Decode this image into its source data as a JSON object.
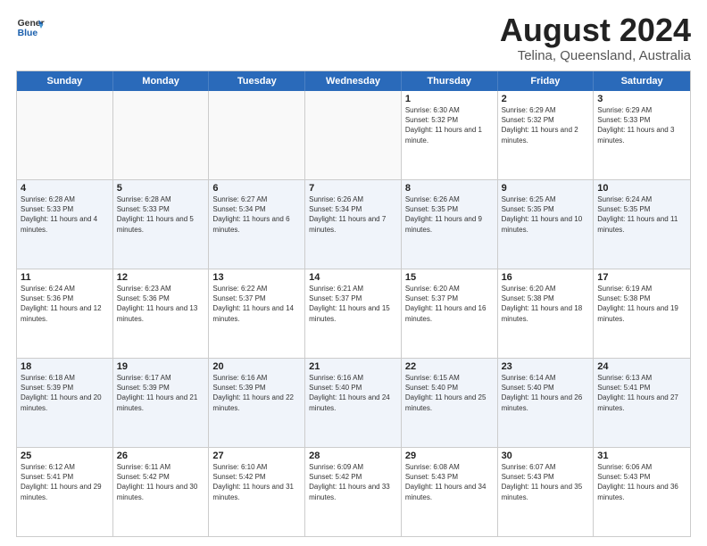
{
  "header": {
    "logo_line1": "General",
    "logo_line2": "Blue",
    "title": "August 2024",
    "subtitle": "Telina, Queensland, Australia"
  },
  "calendar": {
    "days_of_week": [
      "Sunday",
      "Monday",
      "Tuesday",
      "Wednesday",
      "Thursday",
      "Friday",
      "Saturday"
    ],
    "weeks": [
      [
        {
          "day": "",
          "empty": true
        },
        {
          "day": "",
          "empty": true
        },
        {
          "day": "",
          "empty": true
        },
        {
          "day": "",
          "empty": true
        },
        {
          "day": "1",
          "sunrise": "6:30 AM",
          "sunset": "5:32 PM",
          "daylight": "11 hours and 1 minute."
        },
        {
          "day": "2",
          "sunrise": "6:29 AM",
          "sunset": "5:32 PM",
          "daylight": "11 hours and 2 minutes."
        },
        {
          "day": "3",
          "sunrise": "6:29 AM",
          "sunset": "5:33 PM",
          "daylight": "11 hours and 3 minutes."
        }
      ],
      [
        {
          "day": "4",
          "sunrise": "6:28 AM",
          "sunset": "5:33 PM",
          "daylight": "11 hours and 4 minutes."
        },
        {
          "day": "5",
          "sunrise": "6:28 AM",
          "sunset": "5:33 PM",
          "daylight": "11 hours and 5 minutes."
        },
        {
          "day": "6",
          "sunrise": "6:27 AM",
          "sunset": "5:34 PM",
          "daylight": "11 hours and 6 minutes."
        },
        {
          "day": "7",
          "sunrise": "6:26 AM",
          "sunset": "5:34 PM",
          "daylight": "11 hours and 7 minutes."
        },
        {
          "day": "8",
          "sunrise": "6:26 AM",
          "sunset": "5:35 PM",
          "daylight": "11 hours and 9 minutes."
        },
        {
          "day": "9",
          "sunrise": "6:25 AM",
          "sunset": "5:35 PM",
          "daylight": "11 hours and 10 minutes."
        },
        {
          "day": "10",
          "sunrise": "6:24 AM",
          "sunset": "5:35 PM",
          "daylight": "11 hours and 11 minutes."
        }
      ],
      [
        {
          "day": "11",
          "sunrise": "6:24 AM",
          "sunset": "5:36 PM",
          "daylight": "11 hours and 12 minutes."
        },
        {
          "day": "12",
          "sunrise": "6:23 AM",
          "sunset": "5:36 PM",
          "daylight": "11 hours and 13 minutes."
        },
        {
          "day": "13",
          "sunrise": "6:22 AM",
          "sunset": "5:37 PM",
          "daylight": "11 hours and 14 minutes."
        },
        {
          "day": "14",
          "sunrise": "6:21 AM",
          "sunset": "5:37 PM",
          "daylight": "11 hours and 15 minutes."
        },
        {
          "day": "15",
          "sunrise": "6:20 AM",
          "sunset": "5:37 PM",
          "daylight": "11 hours and 16 minutes."
        },
        {
          "day": "16",
          "sunrise": "6:20 AM",
          "sunset": "5:38 PM",
          "daylight": "11 hours and 18 minutes."
        },
        {
          "day": "17",
          "sunrise": "6:19 AM",
          "sunset": "5:38 PM",
          "daylight": "11 hours and 19 minutes."
        }
      ],
      [
        {
          "day": "18",
          "sunrise": "6:18 AM",
          "sunset": "5:39 PM",
          "daylight": "11 hours and 20 minutes."
        },
        {
          "day": "19",
          "sunrise": "6:17 AM",
          "sunset": "5:39 PM",
          "daylight": "11 hours and 21 minutes."
        },
        {
          "day": "20",
          "sunrise": "6:16 AM",
          "sunset": "5:39 PM",
          "daylight": "11 hours and 22 minutes."
        },
        {
          "day": "21",
          "sunrise": "6:16 AM",
          "sunset": "5:40 PM",
          "daylight": "11 hours and 24 minutes."
        },
        {
          "day": "22",
          "sunrise": "6:15 AM",
          "sunset": "5:40 PM",
          "daylight": "11 hours and 25 minutes."
        },
        {
          "day": "23",
          "sunrise": "6:14 AM",
          "sunset": "5:40 PM",
          "daylight": "11 hours and 26 minutes."
        },
        {
          "day": "24",
          "sunrise": "6:13 AM",
          "sunset": "5:41 PM",
          "daylight": "11 hours and 27 minutes."
        }
      ],
      [
        {
          "day": "25",
          "sunrise": "6:12 AM",
          "sunset": "5:41 PM",
          "daylight": "11 hours and 29 minutes."
        },
        {
          "day": "26",
          "sunrise": "6:11 AM",
          "sunset": "5:42 PM",
          "daylight": "11 hours and 30 minutes."
        },
        {
          "day": "27",
          "sunrise": "6:10 AM",
          "sunset": "5:42 PM",
          "daylight": "11 hours and 31 minutes."
        },
        {
          "day": "28",
          "sunrise": "6:09 AM",
          "sunset": "5:42 PM",
          "daylight": "11 hours and 33 minutes."
        },
        {
          "day": "29",
          "sunrise": "6:08 AM",
          "sunset": "5:43 PM",
          "daylight": "11 hours and 34 minutes."
        },
        {
          "day": "30",
          "sunrise": "6:07 AM",
          "sunset": "5:43 PM",
          "daylight": "11 hours and 35 minutes."
        },
        {
          "day": "31",
          "sunrise": "6:06 AM",
          "sunset": "5:43 PM",
          "daylight": "11 hours and 36 minutes."
        }
      ]
    ]
  },
  "labels": {
    "sunrise_prefix": "Sunrise: ",
    "sunset_prefix": "Sunset: ",
    "daylight_prefix": "Daylight: "
  }
}
